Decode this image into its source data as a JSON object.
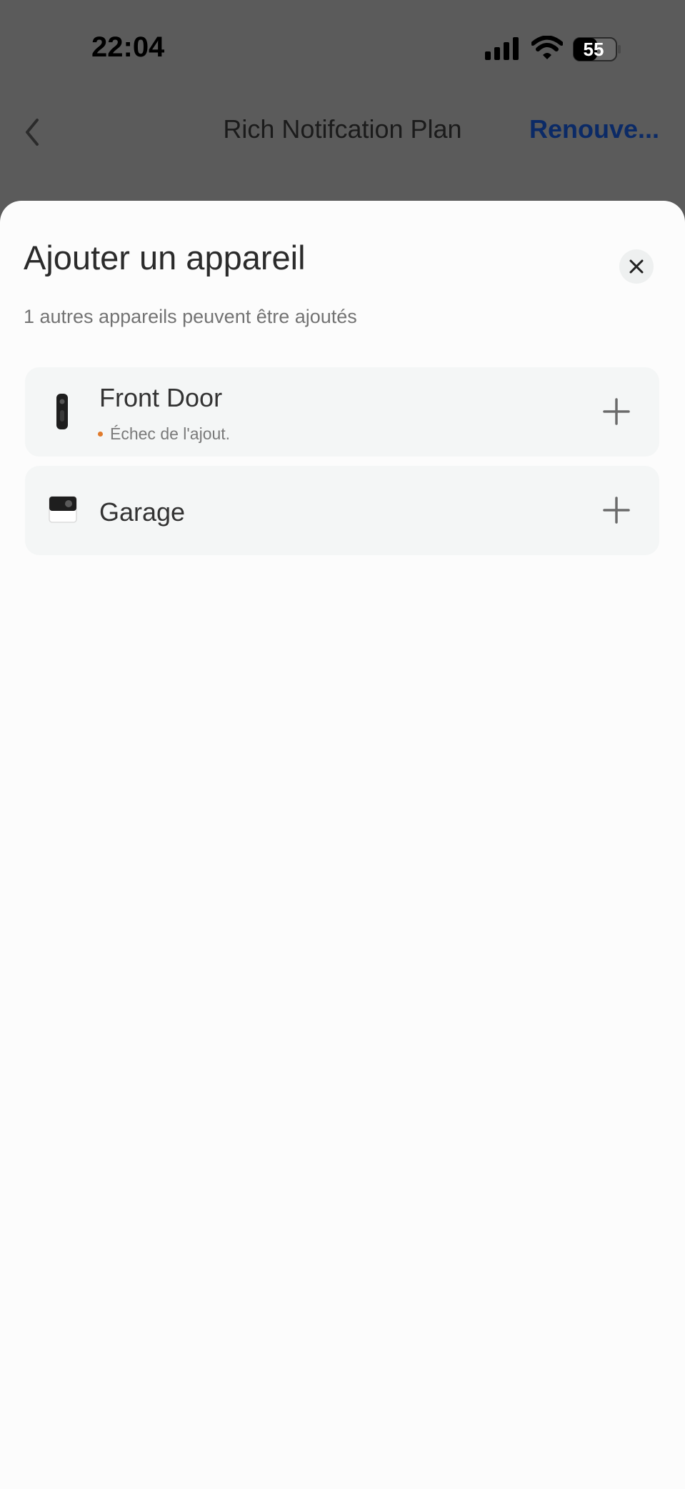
{
  "status_bar": {
    "time": "22:04",
    "battery": "55"
  },
  "nav": {
    "title": "Rich Notifcation Plan",
    "action": "Renouve..."
  },
  "sheet": {
    "title": "Ajouter un appareil",
    "subtitle": "1 autres appareils peuvent être ajoutés",
    "devices": [
      {
        "name": "Front Door",
        "status": "Échec de l'ajout.",
        "icon": "doorbell-icon"
      },
      {
        "name": "Garage",
        "status": "",
        "icon": "camera-icon"
      }
    ]
  },
  "colors": {
    "overlay": "#5b5b5b",
    "sheet_bg": "#fcfcfc",
    "card_bg": "#f4f6f6",
    "accent": "#0b2a66",
    "error_dot": "#e07b2c"
  }
}
